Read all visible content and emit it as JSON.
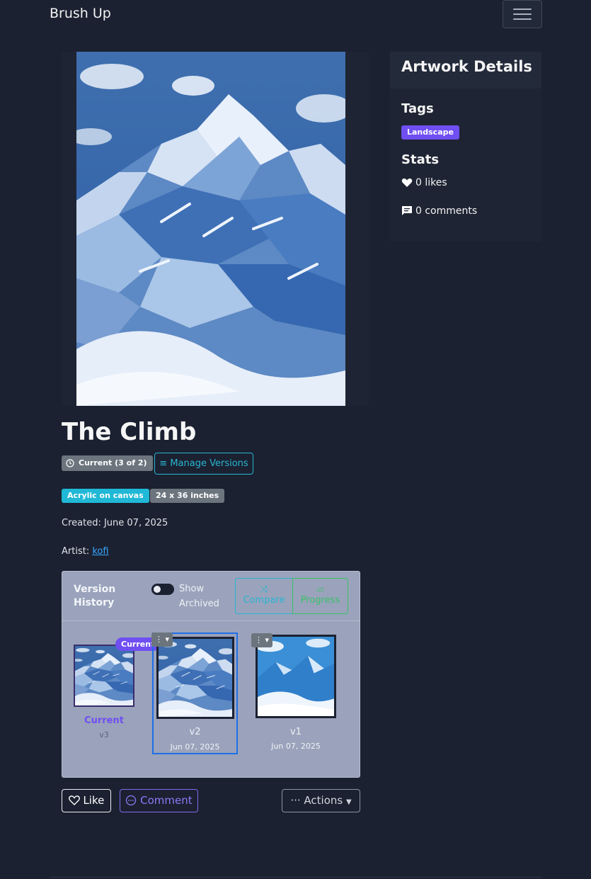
{
  "navbar": {
    "brand": "Brush Up",
    "menu_icon": "hamburger-icon"
  },
  "artwork": {
    "title": "The Climb",
    "version_badge": "Current (3 of 2)",
    "manage_versions_label": "Manage Versions",
    "medium_badge": "Acrylic on canvas",
    "dimensions_badge": "24 x 36 inches",
    "created_label": "Created:",
    "created_value": "June 07, 2025",
    "artist_label": "Artist:",
    "artist_name": "kofi"
  },
  "version_history": {
    "title": "Version History",
    "show_archived_label": "Show Archived",
    "show_archived_on": false,
    "compare_label": "Compare",
    "progress_label": "Progress",
    "items": [
      {
        "badge": "Current",
        "label": "Current",
        "version": "v3",
        "date": ""
      },
      {
        "label": "v2",
        "date": "Jun 07, 2025",
        "selected": true
      },
      {
        "label": "v1",
        "date": "Jun 07, 2025",
        "selected": false
      }
    ]
  },
  "actions": {
    "like_label": "Like",
    "comment_label": "Comment",
    "more_label": "Actions"
  },
  "details_panel": {
    "title": "Artwork Details",
    "tags_heading": "Tags",
    "tags": [
      "Landscape"
    ],
    "stats_heading": "Stats",
    "likes_text": "0 likes",
    "comments_text": "0 comments"
  },
  "colors": {
    "background": "#1b2131",
    "accent_purple": "#6f4ef2",
    "accent_cyan": "#28b5d1",
    "accent_green": "#3bbf6a",
    "selected_blue": "#1e6fe8"
  }
}
